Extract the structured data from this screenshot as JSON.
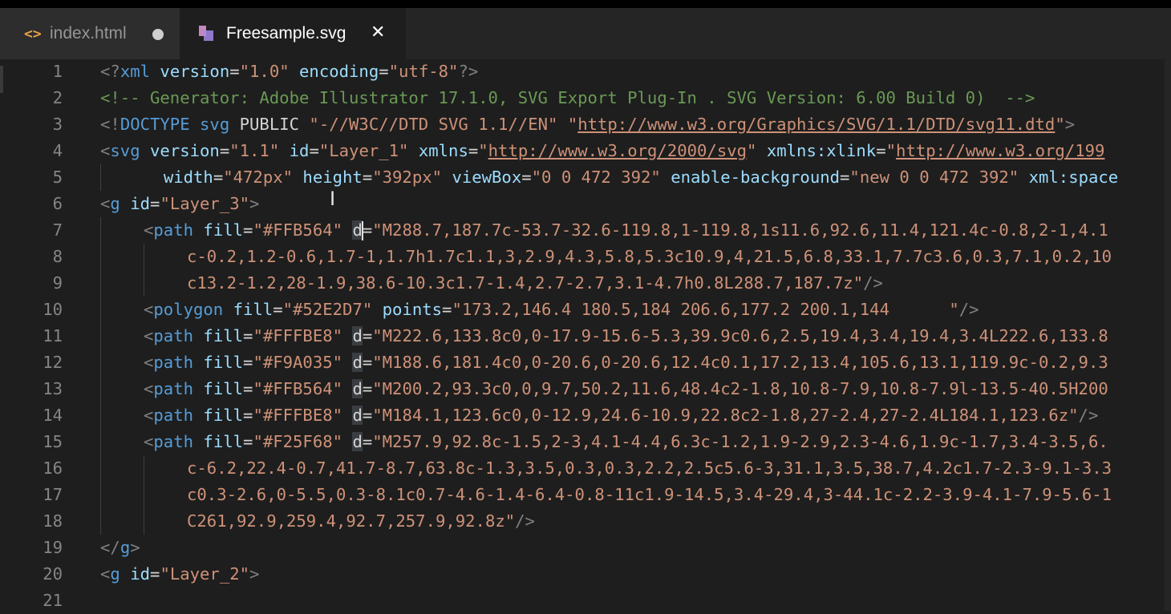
{
  "tabs": [
    {
      "label": "index.html",
      "icon": "code-brackets-icon",
      "modified": true,
      "active": false
    },
    {
      "label": "Freesample.svg",
      "icon": "svg-file-icon",
      "modified": false,
      "active": true
    }
  ],
  "editor": {
    "lines": [
      {
        "n": "1",
        "indent": 0,
        "cursor": false,
        "tokens": [
          [
            "punc",
            "<?"
          ],
          [
            "tag",
            "xml"
          ],
          [
            "plain",
            " "
          ],
          [
            "attr",
            "version"
          ],
          [
            "plain",
            "="
          ],
          [
            "str",
            "\"1.0\""
          ],
          [
            "plain",
            " "
          ],
          [
            "attr",
            "encoding"
          ],
          [
            "plain",
            "="
          ],
          [
            "str",
            "\"utf-8\""
          ],
          [
            "punc",
            "?>"
          ]
        ]
      },
      {
        "n": "2",
        "indent": 0,
        "cursor": false,
        "tokens": [
          [
            "com",
            "<!-- Generator: Adobe Illustrator 17.1.0, SVG Export Plug-In . SVG Version: 6.00 Build 0)  -->"
          ]
        ]
      },
      {
        "n": "3",
        "indent": 0,
        "cursor": false,
        "tokens": [
          [
            "punc",
            "<!"
          ],
          [
            "tag",
            "DOCTYPE"
          ],
          [
            "plain",
            " "
          ],
          [
            "tag",
            "svg"
          ],
          [
            "plain",
            " PUBLIC "
          ],
          [
            "str",
            "\"-//W3C//DTD SVG 1.1//EN\""
          ],
          [
            "plain",
            " "
          ],
          [
            "str",
            "\""
          ],
          [
            "url",
            "http://www.w3.org/Graphics/SVG/1.1/DTD/svg11.dtd"
          ],
          [
            "str",
            "\""
          ],
          [
            "punc",
            ">"
          ]
        ]
      },
      {
        "n": "4",
        "indent": 0,
        "cursor": false,
        "tokens": [
          [
            "punc",
            "<"
          ],
          [
            "tag",
            "svg"
          ],
          [
            "plain",
            " "
          ],
          [
            "attr",
            "version"
          ],
          [
            "plain",
            "="
          ],
          [
            "str",
            "\"1.1\""
          ],
          [
            "plain",
            " "
          ],
          [
            "attr",
            "id"
          ],
          [
            "plain",
            "="
          ],
          [
            "str",
            "\"Layer_1\""
          ],
          [
            "plain",
            " "
          ],
          [
            "attr",
            "xmlns"
          ],
          [
            "plain",
            "="
          ],
          [
            "str",
            "\""
          ],
          [
            "url",
            "http://www.w3.org/2000/svg"
          ],
          [
            "str",
            "\""
          ],
          [
            "plain",
            " "
          ],
          [
            "attr",
            "xmlns:xlink"
          ],
          [
            "plain",
            "="
          ],
          [
            "str",
            "\""
          ],
          [
            "url",
            "http://www.w3.org/199"
          ]
        ]
      },
      {
        "n": "5",
        "indent": 1,
        "cursor": false,
        "tokens": [
          [
            "plain",
            "  "
          ],
          [
            "attr",
            "width"
          ],
          [
            "plain",
            "="
          ],
          [
            "str",
            "\"472px\""
          ],
          [
            "plain",
            " "
          ],
          [
            "attr",
            "height"
          ],
          [
            "plain",
            "="
          ],
          [
            "str",
            "\"392px\""
          ],
          [
            "plain",
            " "
          ],
          [
            "attr",
            "viewBox"
          ],
          [
            "plain",
            "="
          ],
          [
            "str",
            "\"0 0 472 392\""
          ],
          [
            "plain",
            " "
          ],
          [
            "attr",
            "enable-background"
          ],
          [
            "plain",
            "="
          ],
          [
            "str",
            "\"new 0 0 472 392\""
          ],
          [
            "plain",
            " "
          ],
          [
            "attr",
            "xml:space"
          ]
        ]
      },
      {
        "n": "6",
        "indent": 0,
        "cursor": false,
        "tokens": [
          [
            "punc",
            "<"
          ],
          [
            "tag",
            "g"
          ],
          [
            "plain",
            " "
          ],
          [
            "attr",
            "id"
          ],
          [
            "plain",
            "="
          ],
          [
            "str",
            "\"Layer_3\""
          ],
          [
            "punc",
            ">"
          ]
        ]
      },
      {
        "n": "7",
        "indent": 1,
        "cursor": true,
        "tokens": [
          [
            "punc",
            "<"
          ],
          [
            "tag",
            "path"
          ],
          [
            "plain",
            " "
          ],
          [
            "attr",
            "fill"
          ],
          [
            "plain",
            "="
          ],
          [
            "str",
            "\"#FFB564\""
          ],
          [
            "plain",
            " "
          ],
          [
            "sel",
            "d"
          ],
          [
            "cursor",
            ""
          ],
          [
            "plain",
            "="
          ],
          [
            "str",
            "\"M288.7,187.7c-53.7-32.6-119.8,1-119.8,1s11.6,92.6,11.4,121.4c-0.8,2-1,4.1"
          ]
        ]
      },
      {
        "n": "8",
        "indent": 2,
        "cursor": false,
        "tokens": [
          [
            "str",
            "c-0.2,1.2-0.6,1.7-1,1.7h1.7c1.1,3,2.9,4.3,5.8,5.3c10.9,4,21.5,6.8,33.1,7.7c3.6,0.3,7.1,0.2,10"
          ]
        ]
      },
      {
        "n": "9",
        "indent": 2,
        "cursor": false,
        "tokens": [
          [
            "str",
            "c13.2-1.2,28-1.9,38.6-10.3c1.7-1.4,2.7-2.7,3.1-4.7h0.8L288.7,187.7z\""
          ],
          [
            "punc",
            "/>"
          ]
        ]
      },
      {
        "n": "10",
        "indent": 1,
        "cursor": false,
        "tokens": [
          [
            "punc",
            "<"
          ],
          [
            "tag",
            "polygon"
          ],
          [
            "plain",
            " "
          ],
          [
            "attr",
            "fill"
          ],
          [
            "plain",
            "="
          ],
          [
            "str",
            "\"#52E2D7\""
          ],
          [
            "plain",
            " "
          ],
          [
            "attr",
            "points"
          ],
          [
            "plain",
            "="
          ],
          [
            "str",
            "\"173.2,146.4 180.5,184 206.6,177.2 200.1,144      \""
          ],
          [
            "punc",
            "/>"
          ]
        ]
      },
      {
        "n": "11",
        "indent": 1,
        "cursor": false,
        "tokens": [
          [
            "punc",
            "<"
          ],
          [
            "tag",
            "path"
          ],
          [
            "plain",
            " "
          ],
          [
            "attr",
            "fill"
          ],
          [
            "plain",
            "="
          ],
          [
            "str",
            "\"#FFFBE8\""
          ],
          [
            "plain",
            " "
          ],
          [
            "sel",
            "d"
          ],
          [
            "plain",
            "="
          ],
          [
            "str",
            "\"M222.6,133.8c0,0-17.9-15.6-5.3,39.9c0.6,2.5,19.4,3.4,19.4,3.4L222.6,133.8"
          ]
        ]
      },
      {
        "n": "12",
        "indent": 1,
        "cursor": false,
        "tokens": [
          [
            "punc",
            "<"
          ],
          [
            "tag",
            "path"
          ],
          [
            "plain",
            " "
          ],
          [
            "attr",
            "fill"
          ],
          [
            "plain",
            "="
          ],
          [
            "str",
            "\"#F9A035\""
          ],
          [
            "plain",
            " "
          ],
          [
            "sel",
            "d"
          ],
          [
            "plain",
            "="
          ],
          [
            "str",
            "\"M188.6,181.4c0,0-20.6,0-20.6,12.4c0.1,17.2,13.4,105.6,13.1,119.9c-0.2,9.3"
          ]
        ]
      },
      {
        "n": "13",
        "indent": 1,
        "cursor": false,
        "tokens": [
          [
            "punc",
            "<"
          ],
          [
            "tag",
            "path"
          ],
          [
            "plain",
            " "
          ],
          [
            "attr",
            "fill"
          ],
          [
            "plain",
            "="
          ],
          [
            "str",
            "\"#FFB564\""
          ],
          [
            "plain",
            " "
          ],
          [
            "sel",
            "d"
          ],
          [
            "plain",
            "="
          ],
          [
            "str",
            "\"M200.2,93.3c0,0,9.7,50.2,11.6,48.4c2-1.8,10.8-7.9,10.8-7.9l-13.5-40.5H200"
          ]
        ]
      },
      {
        "n": "14",
        "indent": 1,
        "cursor": false,
        "tokens": [
          [
            "punc",
            "<"
          ],
          [
            "tag",
            "path"
          ],
          [
            "plain",
            " "
          ],
          [
            "attr",
            "fill"
          ],
          [
            "plain",
            "="
          ],
          [
            "str",
            "\"#FFFBE8\""
          ],
          [
            "plain",
            " "
          ],
          [
            "sel",
            "d"
          ],
          [
            "plain",
            "="
          ],
          [
            "str",
            "\"M184.1,123.6c0,0-12.9,24.6-10.9,22.8c2-1.8,27-2.4,27-2.4L184.1,123.6z\""
          ],
          [
            "punc",
            "/>"
          ]
        ]
      },
      {
        "n": "15",
        "indent": 1,
        "cursor": false,
        "tokens": [
          [
            "punc",
            "<"
          ],
          [
            "tag",
            "path"
          ],
          [
            "plain",
            " "
          ],
          [
            "attr",
            "fill"
          ],
          [
            "plain",
            "="
          ],
          [
            "str",
            "\"#F25F68\""
          ],
          [
            "plain",
            " "
          ],
          [
            "sel",
            "d"
          ],
          [
            "plain",
            "="
          ],
          [
            "str",
            "\"M257.9,92.8c-1.5,2-3,4.1-4.4,6.3c-1.2,1.9-2.9,2.3-4.6,1.9c-1.7,3.4-3.5,6."
          ]
        ]
      },
      {
        "n": "16",
        "indent": 2,
        "cursor": false,
        "tokens": [
          [
            "str",
            "c-6.2,22.4-0.7,41.7-8.7,63.8c-1.3,3.5,0.3,0.3,2.2,2.5c5.6-3,31.1,3.5,38.7,4.2c1.7-2.3-9.1-3.3"
          ]
        ]
      },
      {
        "n": "17",
        "indent": 2,
        "cursor": false,
        "tokens": [
          [
            "str",
            "c0.3-2.6,0-5.5,0.3-8.1c0.7-4.6-1.4-6.4-0.8-11c1.9-14.5,3.4-29.4,3-44.1c-2.2-3.9-4.1-7.9-5.6-1"
          ]
        ]
      },
      {
        "n": "18",
        "indent": 2,
        "cursor": false,
        "tokens": [
          [
            "str",
            "C261,92.9,259.4,92.7,257.9,92.8z\""
          ],
          [
            "punc",
            "/>"
          ]
        ]
      },
      {
        "n": "19",
        "indent": 0,
        "cursor": false,
        "tokens": [
          [
            "punc",
            "</"
          ],
          [
            "tag",
            "g"
          ],
          [
            "punc",
            ">"
          ]
        ]
      },
      {
        "n": "20",
        "indent": 0,
        "cursor": false,
        "tokens": [
          [
            "punc",
            "<"
          ],
          [
            "tag",
            "g"
          ],
          [
            "plain",
            " "
          ],
          [
            "attr",
            "id"
          ],
          [
            "plain",
            "="
          ],
          [
            "str",
            "\"Layer_2\""
          ],
          [
            "punc",
            ">"
          ]
        ]
      },
      {
        "n": "21",
        "indent": 0,
        "cursor": false,
        "tokens": []
      }
    ]
  },
  "colors": {
    "background": "#1e1e1e",
    "tab_bar": "#252526",
    "tag": "#569cd6",
    "attribute": "#9cdcfe",
    "string": "#ce9178",
    "comment": "#6a9955",
    "line_number": "#858585",
    "modified_dot": "#cfcfcf",
    "tab_html_icon": "#e8a245"
  }
}
